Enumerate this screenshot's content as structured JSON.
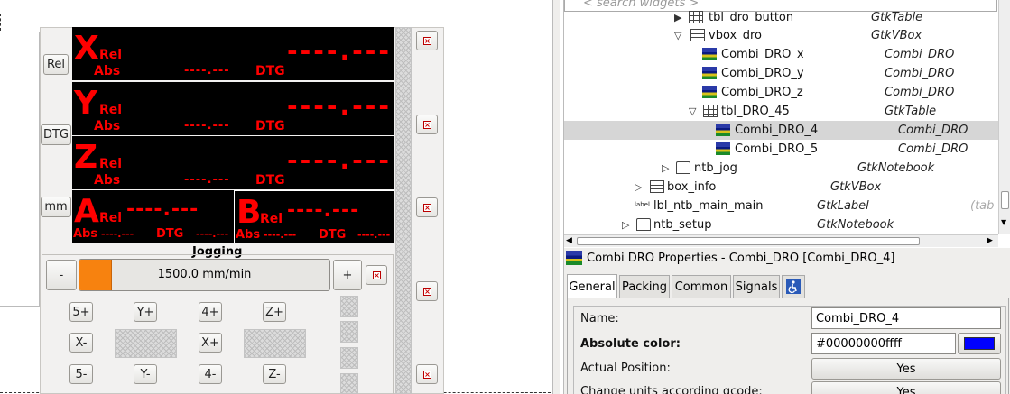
{
  "side_buttons": {
    "rel": "Rel",
    "dtg": "DTG",
    "mm": "mm"
  },
  "dro": {
    "rows": [
      {
        "axis": "X",
        "rel": "Rel",
        "abs": "Abs",
        "abs_value": "----.---",
        "dtg": "DTG",
        "main_value": "----.---"
      },
      {
        "axis": "Y",
        "rel": "Rel",
        "abs": "Abs",
        "abs_value": "----.---",
        "dtg": "DTG",
        "main_value": "----.---"
      },
      {
        "axis": "Z",
        "rel": "Rel",
        "abs": "Abs",
        "abs_value": "----.---",
        "dtg": "DTG",
        "main_value": "----.---"
      }
    ],
    "a": {
      "axis": "A",
      "rel": "Rel",
      "abs": "Abs",
      "abs_value": "----.---",
      "dtg": "DTG",
      "main_value": "----.---"
    },
    "b": {
      "axis": "B",
      "rel": "Rel",
      "abs": "Abs",
      "abs_value": "----.---",
      "dtg": "DTG",
      "main_value": "----.---"
    }
  },
  "jogging": {
    "title": "Jogging",
    "minus": "-",
    "plus": "+",
    "speed": "1500.0 mm/min",
    "speed_fraction": 0.13,
    "buttons": {
      "x_plus5": "5+",
      "y_plus": "Y+",
      "four_plus": "4+",
      "z_plus": "Z+",
      "x_minus": "X-",
      "x_plus": "X+",
      "five_minus": "5-",
      "y_minus": "Y-",
      "four_minus": "4-",
      "z_minus": "Z-"
    }
  },
  "tree": {
    "search_placeholder": "< search widgets >",
    "rows": [
      {
        "name": "tbl_dro_button",
        "type": "GtkTable",
        "icon": "table-icon",
        "expander": "collapsed"
      },
      {
        "name": "vbox_dro",
        "type": "GtkVBox",
        "icon": "vbox-icon",
        "expander": "expanded"
      },
      {
        "name": "Combi_DRO_x",
        "type": "Combi_DRO",
        "icon": "combi-dro-icon",
        "expander": "none"
      },
      {
        "name": "Combi_DRO_y",
        "type": "Combi_DRO",
        "icon": "combi-dro-icon",
        "expander": "none"
      },
      {
        "name": "Combi_DRO_z",
        "type": "Combi_DRO",
        "icon": "combi-dro-icon",
        "expander": "none"
      },
      {
        "name": "tbl_DRO_45",
        "type": "GtkTable",
        "icon": "table-icon",
        "expander": "expanded"
      },
      {
        "name": "Combi_DRO_4",
        "type": "Combi_DRO",
        "icon": "combi-dro-icon",
        "expander": "none",
        "selected": true
      },
      {
        "name": "Combi_DRO_5",
        "type": "Combi_DRO",
        "icon": "combi-dro-icon",
        "expander": "none"
      },
      {
        "name": "ntb_jog",
        "type": "GtkNotebook",
        "icon": "notebook-icon",
        "expander": "collapsed"
      },
      {
        "name": "box_info",
        "type": "GtkVBox",
        "icon": "vbox-icon",
        "expander": "collapsed"
      },
      {
        "name": "lbl_ntb_main_main",
        "type": "GtkLabel",
        "icon": "label-icon",
        "icon_text": "label",
        "expander": "none",
        "extra": "(tab"
      },
      {
        "name": "ntb_setup",
        "type": "GtkNotebook",
        "icon": "notebook-icon",
        "expander": "collapsed"
      }
    ]
  },
  "properties": {
    "title": "Combi DRO Properties - Combi_DRO [Combi_DRO_4]",
    "tabs": [
      "General",
      "Packing",
      "Common",
      "Signals"
    ],
    "name_label": "Name:",
    "name_value": "Combi_DRO_4",
    "abs_color_label": "Absolute color:",
    "abs_color_value": "#00000000ffff",
    "abs_color_swatch": "#0000ff",
    "actual_position_label": "Actual Position:",
    "actual_position_value": "Yes",
    "change_units_label": "Change units according gcode:",
    "change_units_value": "Yes"
  },
  "colors": {
    "dro_text": "#ff0000",
    "dro_bg": "#000000",
    "jog_slider": "#f7820f",
    "selected_row": "#d6d6d6"
  }
}
